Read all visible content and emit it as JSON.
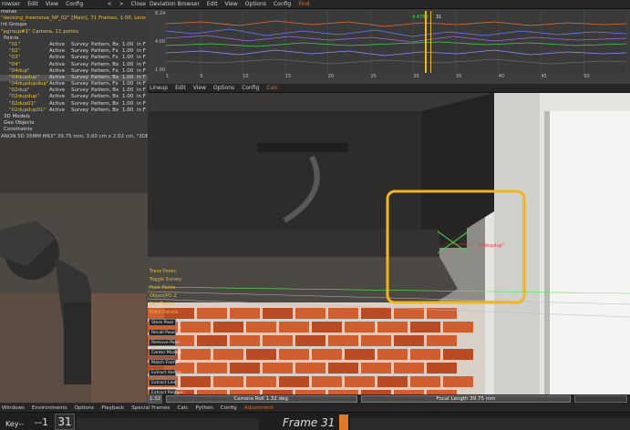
{
  "browser": {
    "menu": [
      "rowser",
      "Edit",
      "View",
      "Config"
    ],
    "controls": [
      "<",
      ">",
      "Close"
    ],
    "items": [
      {
        "text": "meras"
      },
      {
        "text": "\"decking_freemove_NP_02\"  [Main], 71 Frames, 1.00, Lens -> \"CANO",
        "color": "#e8c43a"
      },
      {
        "text": "int Groups"
      },
      {
        "text": "\"pgroup#1\"  Camera, 11 points",
        "color": "#e8c43a"
      },
      {
        "text": "Points",
        "indent": 4
      }
    ],
    "points": [
      {
        "name": "\"01\"",
        "status": "Active",
        "type": "Survey",
        "pattern": "Pattern, Bx",
        "weight": "1.00",
        "suffix": "in F"
      },
      {
        "name": "\"02\"",
        "status": "Active",
        "type": "Survey",
        "pattern": "Pattern, Fx",
        "weight": "1.00",
        "suffix": "in F"
      },
      {
        "name": "\"03\"",
        "status": "Active",
        "type": "Survey",
        "pattern": "Pattern, Fx",
        "weight": "1.00",
        "suffix": "in F"
      },
      {
        "name": "\"04\"",
        "status": "Active",
        "type": "Survey",
        "pattern": "Pattern, Bx",
        "weight": "1.00",
        "suffix": "in F"
      },
      {
        "name": "\"04dup\"",
        "status": "Active",
        "type": "Survey",
        "pattern": "Pattern, Fx",
        "weight": "1.00",
        "suffix": "in F"
      },
      {
        "name": "\"04dupdup\"",
        "status": "Active",
        "type": "Survey",
        "pattern": "Pattern, Bx",
        "weight": "1.00",
        "suffix": "in F",
        "selected": true
      },
      {
        "name": "\"04dupdupdup\"",
        "status": "Active",
        "type": "Survey",
        "pattern": "Pattern, Fx",
        "weight": "1.00",
        "suffix": "in F"
      },
      {
        "name": "\"02dup\"",
        "status": "Active",
        "type": "Survey",
        "pattern": "Pattern, Bx",
        "weight": "1.00",
        "suffix": "in F"
      },
      {
        "name": "\"02dupdup\"",
        "status": "Active",
        "type": "Survey",
        "pattern": "Pattern, Bx",
        "weight": "1.00",
        "suffix": "in F"
      },
      {
        "name": "\"02dup01\"",
        "status": "Active",
        "type": "Survey",
        "pattern": "Pattern, Bx",
        "weight": "1.00",
        "suffix": "in F"
      },
      {
        "name": "\"02dupdup01\"",
        "status": "Active",
        "type": "Survey",
        "pattern": "Pattern, Bx",
        "weight": "1.00",
        "suffix": "in F"
      }
    ],
    "tree_tail": [
      "3D Models",
      "Geo Objects",
      "Constraints"
    ],
    "camera_info": "ANON 5D 35MM MK3\"  39.75 mm, 3.60 cm x 2.02 cm, \"3DE Classic LD N"
  },
  "graph": {
    "menu": [
      "Deviation Browser",
      "Edit",
      "View",
      "Options",
      "Config",
      "Find"
    ],
    "y_ticks": [
      "8.24",
      "4.00",
      "1.00"
    ],
    "x_ticks": [
      "1",
      "5",
      "10",
      "15",
      "20",
      "25",
      "30",
      "35",
      "40",
      "45",
      "50"
    ],
    "cursor_value": "4.4788",
    "cursor_frame": "31"
  },
  "viewport": {
    "menu": [
      "Lineup",
      "Edit",
      "View",
      "Options",
      "Config",
      "Calc"
    ],
    "point_label": "\"04dupdup\"",
    "tools_labels": [
      "Trans Poses",
      "Toggle Survey",
      "Push Points",
      "Object/PG Z",
      "Edit Tracks",
      "Point Details"
    ],
    "tool_buttons": [
      "Store Pose",
      "Recall Pose",
      "Remove Pose",
      "Center Models",
      "Match Frame",
      "Extract Vertex",
      "Extract Line",
      "Extract Polygon"
    ],
    "status_zoom": "1.32",
    "status_camera_roll": "Camera Roll 1.32 deg.",
    "status_focal": "Focal Length 39.75 mm"
  },
  "bottom_menu": [
    "Windows",
    "Environments",
    "Options",
    "Playback",
    "Special Frames",
    "Calc",
    "Python",
    "Config",
    "Adjustment"
  ],
  "timeline": {
    "key_label": "Key--",
    "prev": "--1",
    "frame_num": "31",
    "frame_title": "Frame 31"
  },
  "colors": {
    "highlight": "#f2b51e",
    "accent_orange": "#e06b2a",
    "point_green": "#44dd44",
    "point_label": "#ff3344"
  }
}
